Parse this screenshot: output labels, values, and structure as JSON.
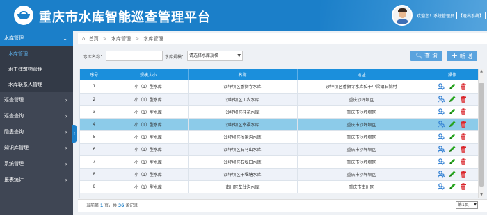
{
  "header": {
    "title": "重庆市水库智能巡查管理平台",
    "welcome": "欢迎您！系统管理员",
    "exit_label": "【退出系统】",
    "fullscreen_label": "全屏"
  },
  "sidebar": {
    "items": [
      {
        "label": "水库管理",
        "open": true
      },
      {
        "label": "巡查管理"
      },
      {
        "label": "巡查查询"
      },
      {
        "label": "隐患查询"
      },
      {
        "label": "知识库管理"
      },
      {
        "label": "系统管理"
      },
      {
        "label": "报表统计"
      }
    ],
    "subitems": [
      {
        "label": "水库管理",
        "active": true
      },
      {
        "label": "水工建筑物管理"
      },
      {
        "label": "水库联系人管理"
      }
    ]
  },
  "breadcrumb": {
    "home": "首页",
    "level1": "水库管理",
    "level2": "水库管理"
  },
  "search": {
    "name_label": "水库名称：",
    "name_value": "",
    "scale_label": "水库规模：",
    "scale_selected": "请选择水库规模",
    "query_label": "查 询",
    "add_label": "新 增"
  },
  "table": {
    "columns": [
      "序号",
      "规模大小",
      "名称",
      "地址",
      "操作"
    ],
    "rows": [
      {
        "no": "1",
        "scale": "小（1）型水库",
        "name": "沙坪坝区香獅寺水库",
        "address": "沙坪坝区香獅寺水库位于中梁镇石院村"
      },
      {
        "no": "2",
        "scale": "小（1）型水库",
        "name": "沙坪坝区工农水库",
        "address": "重庆沙坪坝区"
      },
      {
        "no": "3",
        "scale": "小（1）型水库",
        "name": "沙坪坝区桂花水库",
        "address": "重庆市沙坪坝区"
      },
      {
        "no": "4",
        "scale": "小（1）型水库",
        "name": "沙坪坝区幸福水库",
        "address": "重庆市沙坪坝区"
      },
      {
        "no": "5",
        "scale": "小（1）型水库",
        "name": "沙坪坝区杨家沟水库",
        "address": "重庆市沙坪坝区"
      },
      {
        "no": "6",
        "scale": "小（1）型水库",
        "name": "沙坪坝区石马山水库",
        "address": "重庆市沙坪坝区"
      },
      {
        "no": "7",
        "scale": "小（1）型水库",
        "name": "沙坪坝区石堰口水库",
        "address": "重庆市沙坪坝区"
      },
      {
        "no": "8",
        "scale": "小（1）型水库",
        "name": "沙坪坝区干堰塘水库",
        "address": "重庆市沙坪坝区"
      },
      {
        "no": "9",
        "scale": "小（1）型水库",
        "name": "南川区车仕沟水库",
        "address": "重庆市南川区"
      }
    ],
    "selected_row": 3
  },
  "footer": {
    "prefix": "当前第",
    "current_page": "1",
    "mid": "页，共",
    "total": "36",
    "suffix": "条记录",
    "page_select": "第1页"
  },
  "colors": {
    "primary": "#1b7fc9",
    "sidebar_bg": "#3f4654",
    "table_header": "#1b8fdc",
    "selected_row": "#8ccbe9",
    "edit_icon": "#27a51e",
    "delete_icon": "#d9262c",
    "view_icon": "#2f7fd3"
  }
}
